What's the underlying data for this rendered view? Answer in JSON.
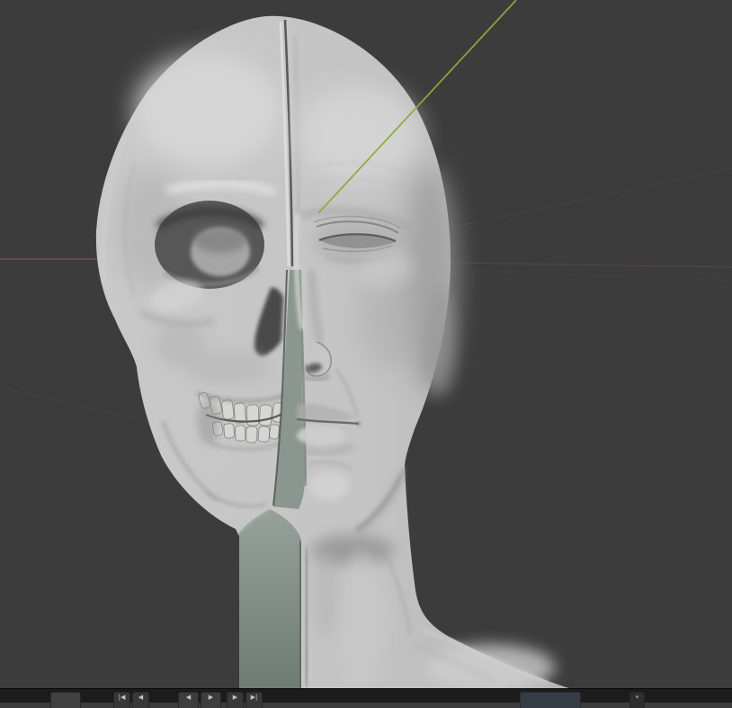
{
  "viewport": {
    "background_color": "#3c3c3c",
    "axis": {
      "y_color": "#8cab39",
      "x_color": "#9b4f60",
      "x_color_faint": "#8a4f5c",
      "grid_color": "#515151"
    },
    "model": {
      "name": "anatomy head study - half skull, half face",
      "base_tone": "#c6c6c6",
      "cut_plane_tone": "#8a968e"
    }
  },
  "timeline": {
    "editor_type_glyph": "",
    "playback_buttons": [
      {
        "name": "jump-to-start",
        "glyph": "|◀"
      },
      {
        "name": "previous-keyframe",
        "glyph": "◀"
      },
      {
        "name": "play-reverse",
        "glyph": "◀"
      },
      {
        "name": "play",
        "glyph": "▶"
      },
      {
        "name": "next-keyframe",
        "glyph": "▶"
      },
      {
        "name": "jump-to-end",
        "glyph": "▶|"
      }
    ],
    "frame_field_value": "",
    "right_button_glyph": "▾"
  }
}
